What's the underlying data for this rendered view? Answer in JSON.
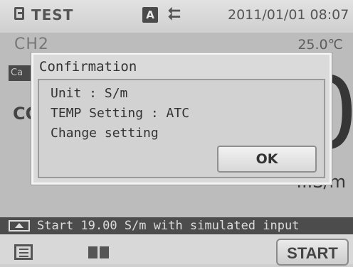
{
  "status_bar": {
    "mode": "TEST",
    "badge": "A",
    "usb_symbol": "⮄",
    "datetime": "2011/01/01 08:07"
  },
  "background": {
    "channel": "CH2",
    "temperature": "25.0℃",
    "cal_label": "Ca",
    "conductivity_label": "CO",
    "big_value_digit": "0",
    "unit": "...S/m"
  },
  "dialog": {
    "title": "Confirmation",
    "lines": [
      "Unit : S/m",
      "TEMP Setting : ATC",
      "Change setting"
    ],
    "ok_label": "OK"
  },
  "info_bar": {
    "text": "Start 19.00 S/m with simulated input"
  },
  "bottom_bar": {
    "start_label": "START"
  }
}
